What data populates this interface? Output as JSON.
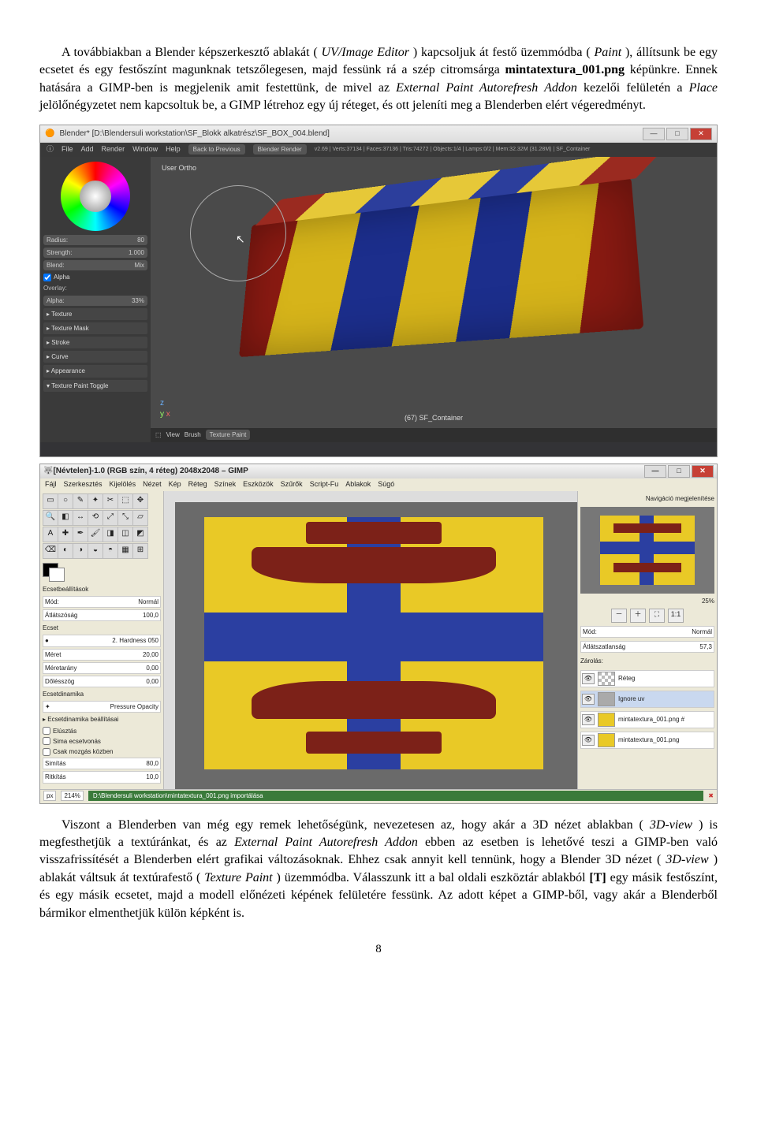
{
  "para1": {
    "t1": "A továbbiakban a Blender képszerkesztő ablakát (",
    "i1": "UV/Image Editor",
    "t2": ") kapcsoljuk át festő üzemmódba (",
    "i2": "Paint",
    "t3": "), állítsunk be egy ecsetet és egy festőszínt magunknak tetszőlegesen, majd fessünk rá a szép citromsárga ",
    "b1": "mintatextura_001.png",
    "t4": " képünkre. Ennek hatására a GIMP-ben is megjelenik amit festettünk, de mivel az ",
    "i3": "External Paint Autorefresh Addon",
    "t5": " kezelői felületén a ",
    "i4": "Place",
    "t6": " jelölőnégyzetet nem kapcsoltuk be, a GIMP létrehoz egy új réteget, és ott jeleníti meg a Blenderben elért végeredményt."
  },
  "blender": {
    "title": "Blender* [D:\\Blendersuli workstation\\SF_Blokk alkatrész\\SF_BOX_004.blend]",
    "menu": {
      "file": "File",
      "add": "Add",
      "render": "Render",
      "window": "Window",
      "help": "Help",
      "back": "Back to Previous",
      "engine": "Blender Render",
      "info": "v2.69 | Verts:37134 | Faces:37136 | Tris:74272 | Objects:1/4 | Lamps:0/2 | Mem:32.32M (31.28M) | SF_Container"
    },
    "side": {
      "ortho": "User Ortho",
      "radius_l": "Radius:",
      "radius_v": "80",
      "strength_l": "Strength:",
      "strength_v": "1.000",
      "blend_l": "Blend:",
      "blend_v": "Mix",
      "alpha_chk": "Alpha",
      "overlay": "Overlay:",
      "alpha_l": "Alpha:",
      "alpha_v": "33%",
      "p1": "▸ Texture",
      "p2": "▸ Texture Mask",
      "p3": "▸ Stroke",
      "p4": "▸ Curve",
      "p5": "▸ Appearance",
      "p6": "▾ Texture Paint Toggle"
    },
    "footer": {
      "view": "View",
      "brush": "Brush",
      "mode": "Texture Paint"
    },
    "obj": "(67) SF_Container"
  },
  "gimp": {
    "title": "[Névtelen]-1.0 (RGB szín, 4 réteg) 2048x2048 – GIMP",
    "menu": {
      "m1": "Fájl",
      "m2": "Szerkesztés",
      "m3": "Kijelölés",
      "m4": "Nézet",
      "m5": "Kép",
      "m6": "Réteg",
      "m7": "Színek",
      "m8": "Eszközök",
      "m9": "Szűrők",
      "m10": "Script-Fu",
      "m11": "Ablakok",
      "m12": "Súgó"
    },
    "left": {
      "opts": "Ecsetbeállítások",
      "mode_l": "Mód:",
      "mode_v": "Normál",
      "opac_l": "Átlátszóság",
      "opac_v": "100,0",
      "brush_l": "Ecset",
      "brush_v": "2. Hardness 050",
      "size_l": "Méret",
      "size_v": "20,00",
      "ratio_l": "Méretarány",
      "ratio_v": "0,00",
      "angle_l": "Dőlésszög",
      "angle_v": "0,00",
      "dyn_l": "Ecsetdinamika",
      "dyn_v": "Pressure Opacity",
      "dynopt": "▸ Ecsetdinamika beállításai",
      "c1": "Elúsztás",
      "c2": "Sima ecsetvonás",
      "c3": "Csak mozgás közben",
      "sm_l": "Simítás",
      "sm_v": "80,0",
      "sp_l": "Ritkítás",
      "sp_v": "10,0"
    },
    "right": {
      "nav": "Navigáció megjelenítése",
      "zoom": "25%",
      "mode_l": "Mód:",
      "mode_v": "Normál",
      "opac_l": "Átlátszatlanság",
      "opac_v": "57,3",
      "lock": "Zárolás:",
      "l1": "Réteg",
      "l2": "Ignore uv",
      "l3": "mintatextura_001.png #",
      "l4": "mintatextura_001.png"
    },
    "status": {
      "px": "px",
      "zoom": "214%",
      "path": "D:\\Blendersuli workstation\\mintatextura_001.png importálása"
    }
  },
  "para2": {
    "t1": "Viszont a Blenderben van még egy remek lehetőségünk, nevezetesen az, hogy akár a 3D nézet ablakban  (",
    "i1": "3D-view",
    "t2": ") is megfesthetjük a textúránkat, és az ",
    "i2": "External Paint Autorefresh Addon",
    "t3": " ebben az esetben is lehetővé teszi a GIMP-ben való visszafrissítését a Blenderben elért grafikai változásoknak. Ehhez csak annyit kell tennünk, hogy a Blender 3D nézet (",
    "i3": "3D-view",
    "t4": ") ablakát váltsuk át textúrafestő (",
    "i4": "Texture Paint",
    "t5": ") üzemmódba. Válasszunk itt a bal oldali eszköztár ablakból ",
    "b1": "[T]",
    "t6": " egy másik festőszínt, és egy másik ecsetet, majd a modell előnézeti képének felületére fessünk. Az adott képet a GIMP-ből, vagy akár a Blenderből bármikor elmenthetjük külön képként is."
  },
  "pagenum": "8"
}
